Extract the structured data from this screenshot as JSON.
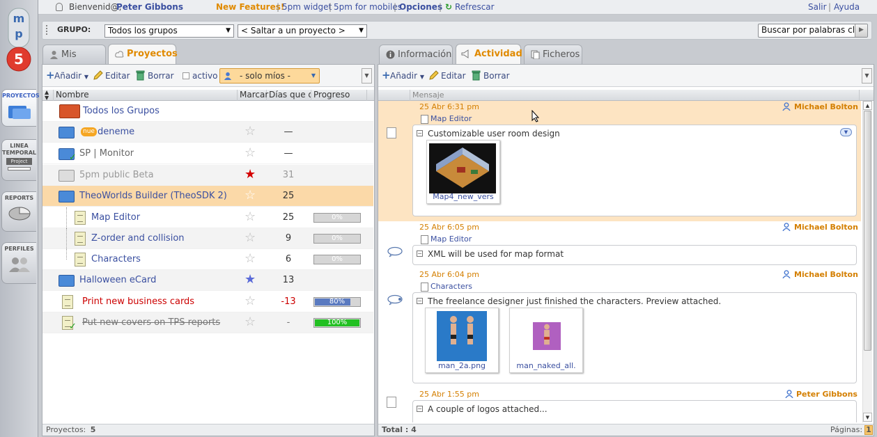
{
  "topbar": {
    "welcome": "Bienvenid@,",
    "user": "Peter Gibbons",
    "new_features": "New Features!",
    "widget": "5pm widget",
    "mobiles": "5pm for mobiles",
    "options": "Opciones",
    "refresh": "Refrescar",
    "logout": "Salir",
    "help": "Ayuda"
  },
  "rail": {
    "logo": "5pm",
    "items": [
      {
        "label": "PROYECTOS"
      },
      {
        "label1": "LINEA",
        "label2": "TEMPORAL",
        "sub": "Project"
      },
      {
        "label": "REPORTS"
      },
      {
        "label": "PERFILES"
      }
    ]
  },
  "groupbar": {
    "label": "GRUPO:",
    "group_select": "Todos los grupos",
    "project_select": "< Saltar a un proyecto >",
    "search_placeholder": "Buscar por palabras cla"
  },
  "left": {
    "tabs": [
      "Mis cosas",
      "Proyectos"
    ],
    "toolbar": {
      "add": "Añadir",
      "edit": "Editar",
      "delete": "Borrar",
      "active": "activo",
      "filter": "- solo míos -"
    },
    "columns": [
      "Nombre",
      "Marcar",
      "Días que q",
      "Progreso"
    ],
    "rows": [
      {
        "name": "Todos los Grupos",
        "star": "",
        "days": "",
        "progress": ""
      },
      {
        "badge": "nue",
        "name": "deneme",
        "star": "☆",
        "days": "—",
        "progress": ""
      },
      {
        "name": "SP | Monitor",
        "star": "☆",
        "days": "—",
        "progress": ""
      },
      {
        "name": "5pm public Beta",
        "star": "☆",
        "days": "31",
        "progress": ""
      },
      {
        "name": "TheoWorlds Builder (TheoSDK 2)",
        "star": "☆",
        "days": "25",
        "progress": ""
      },
      {
        "name": "Map Editor",
        "star": "☆",
        "days": "25",
        "progress": "0%",
        "progress_value": 0
      },
      {
        "name": "Z-order and collision",
        "star": "☆",
        "days": "9",
        "progress": "0%",
        "progress_value": 0
      },
      {
        "name": "Characters",
        "star": "☆",
        "days": "6",
        "progress": "0%",
        "progress_value": 0
      },
      {
        "name": "Halloween eCard",
        "star": "☆",
        "days": "13",
        "progress": ""
      },
      {
        "name": "Print new business cards",
        "star": "☆",
        "days": "-13",
        "progress": "80%",
        "progress_value": 80
      },
      {
        "name": "Put new covers on TPS reports",
        "star": "☆",
        "days": "-",
        "progress": "100%",
        "progress_value": 100
      }
    ],
    "footer_label": "Proyectos:",
    "footer_count": "5"
  },
  "right": {
    "tabs": [
      "Información",
      "Actividad",
      "Ficheros"
    ],
    "toolbar": {
      "add": "Añadir",
      "edit": "Editar",
      "delete": "Borrar"
    },
    "column": "Mensaje",
    "entries": [
      {
        "date": "25 Abr 6:31 pm",
        "user": "Michael Bolton",
        "task": "Map Editor",
        "message": "Customizable user room design",
        "files": [
          "Map4_new_vers"
        ]
      },
      {
        "date": "25 Abr 6:05 pm",
        "user": "Michael Bolton",
        "task": "Map Editor",
        "message": "XML will be used for map format",
        "files": []
      },
      {
        "date": "25 Abr 6:04 pm",
        "user": "Michael Bolton",
        "task": "Characters",
        "message": "The freelance designer just finished the characters. Preview attached.",
        "files": [
          "man_2a.png",
          "man_naked_all."
        ]
      },
      {
        "date": "25 Abr 1:55 pm",
        "user": "Peter Gibbons",
        "task": "",
        "message": "A couple of logos attached...",
        "files": []
      }
    ],
    "footer_total": "Total : 4",
    "footer_pages": "Páginas:",
    "footer_page": "1"
  },
  "colors": {
    "accent": "#e08a00",
    "link": "#3a4fa0",
    "selected_row": "#fbd9a8",
    "overdue": "#cc0000"
  }
}
